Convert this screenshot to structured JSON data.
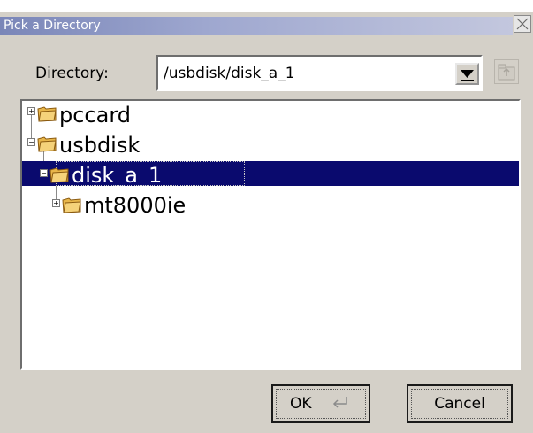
{
  "window": {
    "title": "Pick a Directory"
  },
  "directory": {
    "label": "Directory:",
    "value": "/usbdisk/disk_a_1"
  },
  "tree": {
    "nodes": [
      {
        "label": "pccard",
        "expander": "+"
      },
      {
        "label": "usbdisk",
        "expander": "−"
      },
      {
        "label": "disk_a_1",
        "expander": "−",
        "selected": true
      },
      {
        "label": "mt8000ie",
        "expander": "+"
      }
    ]
  },
  "buttons": {
    "ok_label": "OK",
    "cancel_label": "Cancel"
  },
  "icons": {
    "close": "close-icon",
    "dropdown": "dropdown-arrow-icon",
    "up_folder": "up-folder-icon",
    "folder": "folder-icon",
    "enter": "enter-key-icon"
  },
  "colors": {
    "selection": "#0a0a6e",
    "dialog_bg": "#d4d0c8",
    "title_gradient_start": "#7a86b8"
  }
}
